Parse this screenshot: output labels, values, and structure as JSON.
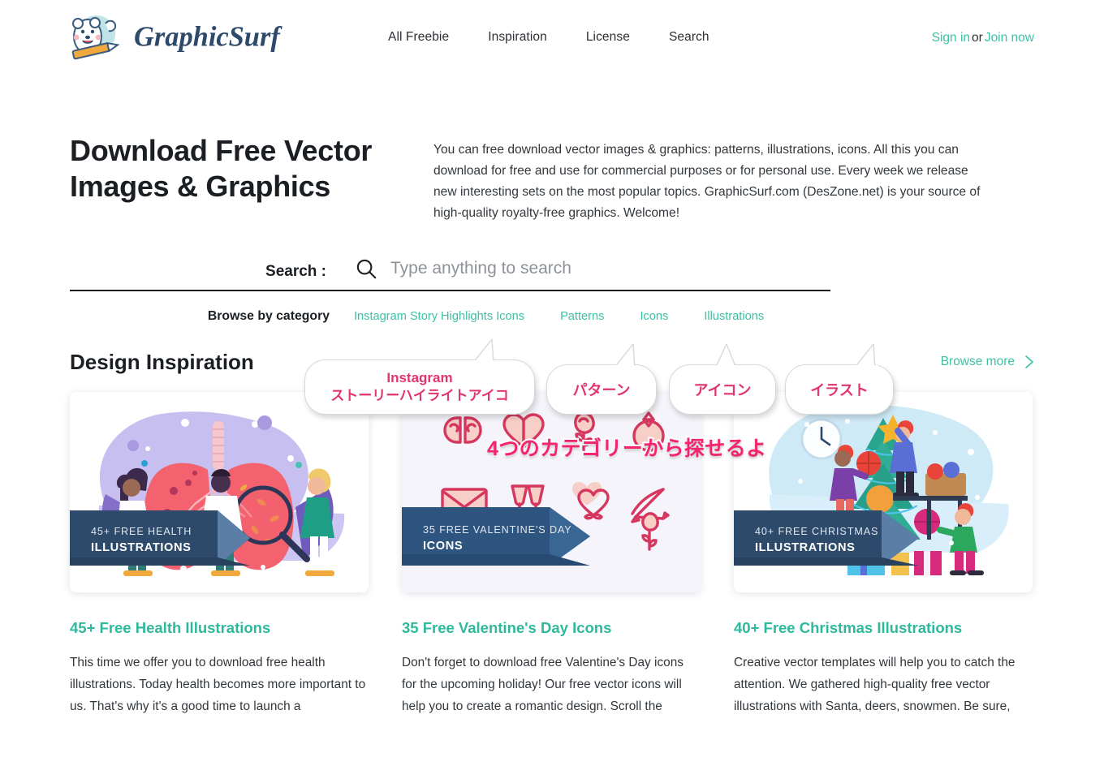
{
  "header": {
    "brand_name": "GraphicSurf",
    "nav": [
      {
        "label": "All Freebie"
      },
      {
        "label": "Inspiration"
      },
      {
        "label": "License"
      },
      {
        "label": "Search"
      }
    ],
    "auth": {
      "sign_in": "Sign in",
      "separator": "or",
      "join_now": "Join now"
    }
  },
  "hero": {
    "title": "Download Free Vector Images & Graphics",
    "description": "You can free download vector images & graphics: patterns, illustrations, icons. All this you can download for free and use for commercial purposes or for personal use. Every week we release new interesting sets on the most popular topics. GraphicSurf.com (DesZone.net) is your source of high-quality royalty-free graphics. Welcome!"
  },
  "search": {
    "label": "Search :",
    "placeholder": "Type anything to search",
    "value": ""
  },
  "categories": {
    "label": "Browse by category",
    "items": [
      {
        "label": "Instagram Story Highlights Icons"
      },
      {
        "label": "Patterns"
      },
      {
        "label": "Icons"
      },
      {
        "label": "Illustrations"
      }
    ]
  },
  "annotations": {
    "bubbles": [
      {
        "line1": "Instagram",
        "line2": "ストーリーハイライトアイコ"
      },
      {
        "line1": "パターン",
        "line2": ""
      },
      {
        "line1": "アイコン",
        "line2": ""
      },
      {
        "line1": "イラスト",
        "line2": ""
      }
    ],
    "note": "4つのカテゴリーから探せるよ"
  },
  "inspiration": {
    "section_title": "Design Inspiration",
    "browse_more": "Browse more",
    "cards": [
      {
        "banner_top": "45+ FREE HEALTH",
        "banner_bottom": "ILLUSTRATIONS",
        "title": "45+ Free Health Illustrations",
        "text": "This time we offer you to download free health illustrations. Today health becomes more important to us. That's why it's a good time to launch a"
      },
      {
        "banner_top": "35 FREE VALENTINE'S DAY",
        "banner_bottom": "ICONS",
        "title": "35 Free Valentine's Day Icons",
        "text": "Don't forget to download free Valentine's Day icons for the upcoming holiday! Our free vector icons will help you to create a romantic design. Scroll the"
      },
      {
        "banner_top": "40+ FREE CHRISTMAS",
        "banner_bottom": "ILLUSTRATIONS",
        "title": "40+ Free Christmas Illustrations",
        "text": "Creative vector templates will help you to catch the attention. We gathered high-quality free vector illustrations with Santa, deers, snowmen. Be sure,"
      }
    ]
  },
  "colors": {
    "accent_teal": "#3dc1a5",
    "card_title_teal": "#2eb99d",
    "annotation_pink": "#e0356f",
    "note_pink": "#f4246f",
    "banner_navy": "#2e4a6b",
    "text_dark": "#1b1f23"
  }
}
